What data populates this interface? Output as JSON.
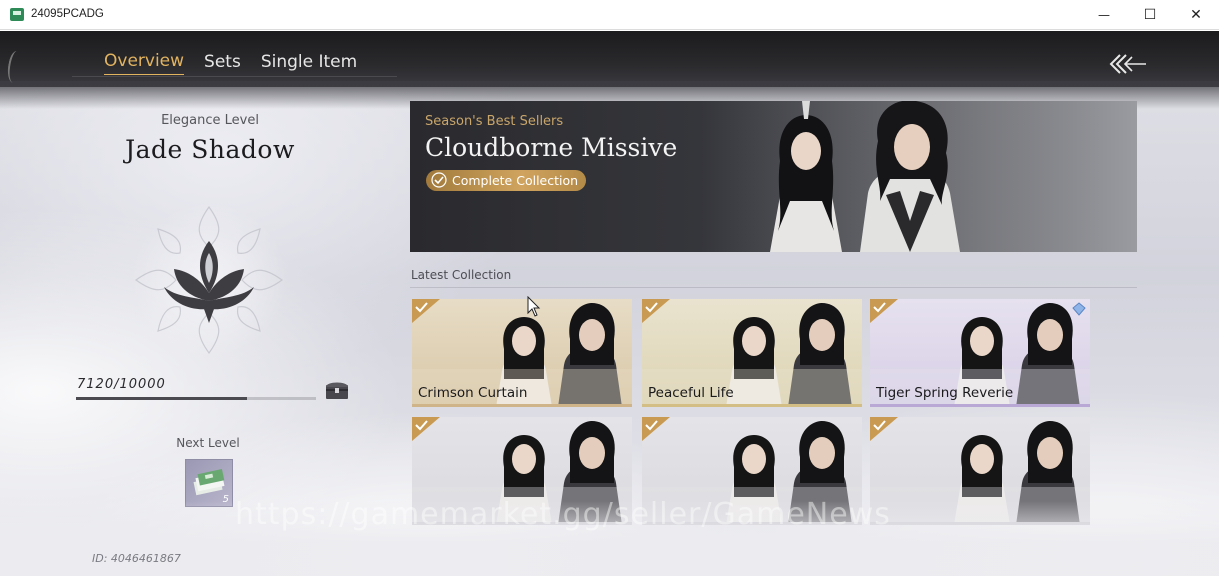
{
  "window": {
    "title": "24095PCADG",
    "minimize_glyph": "—",
    "maximize_glyph": "☐",
    "close_glyph": "✕"
  },
  "tabs": [
    {
      "label": "Overview",
      "active": true
    },
    {
      "label": "Sets",
      "active": false
    },
    {
      "label": "Single Item",
      "active": false
    }
  ],
  "left_panel": {
    "elegance_label": "Elegance Level",
    "elegance_name": "Jade Shadow",
    "emblem_icon": "lotus-icon",
    "progress_text": "7120/10000",
    "progress_current": 7120,
    "progress_max": 10000,
    "chest_icon": "chest-icon",
    "next_level_label": "Next Level",
    "reward_icon": "currency-bundle-icon",
    "reward_count": "5",
    "player_id": "ID: 4046461867"
  },
  "banner": {
    "subtitle": "Season's Best Sellers",
    "title": "Cloudborne Missive",
    "badge": "Complete Collection"
  },
  "latest": {
    "label": "Latest Collection",
    "cards": [
      {
        "name": "Crimson Curtain",
        "theme": "warm",
        "diamond": false
      },
      {
        "name": "Peaceful Life",
        "theme": "gold",
        "diamond": false
      },
      {
        "name": "Tiger Spring Reverie",
        "theme": "purple",
        "diamond": true
      },
      {
        "name": "",
        "theme": "grey",
        "diamond": false
      },
      {
        "name": "",
        "theme": "grey",
        "diamond": false
      },
      {
        "name": "",
        "theme": "grey",
        "diamond": false
      }
    ]
  },
  "watermark": "https://gamemarket.gg/seller/GameNews",
  "colors": {
    "accent_gold": "#e2b460",
    "badge_gold": "#c89a52",
    "card_purple": "#b9a7d6"
  }
}
